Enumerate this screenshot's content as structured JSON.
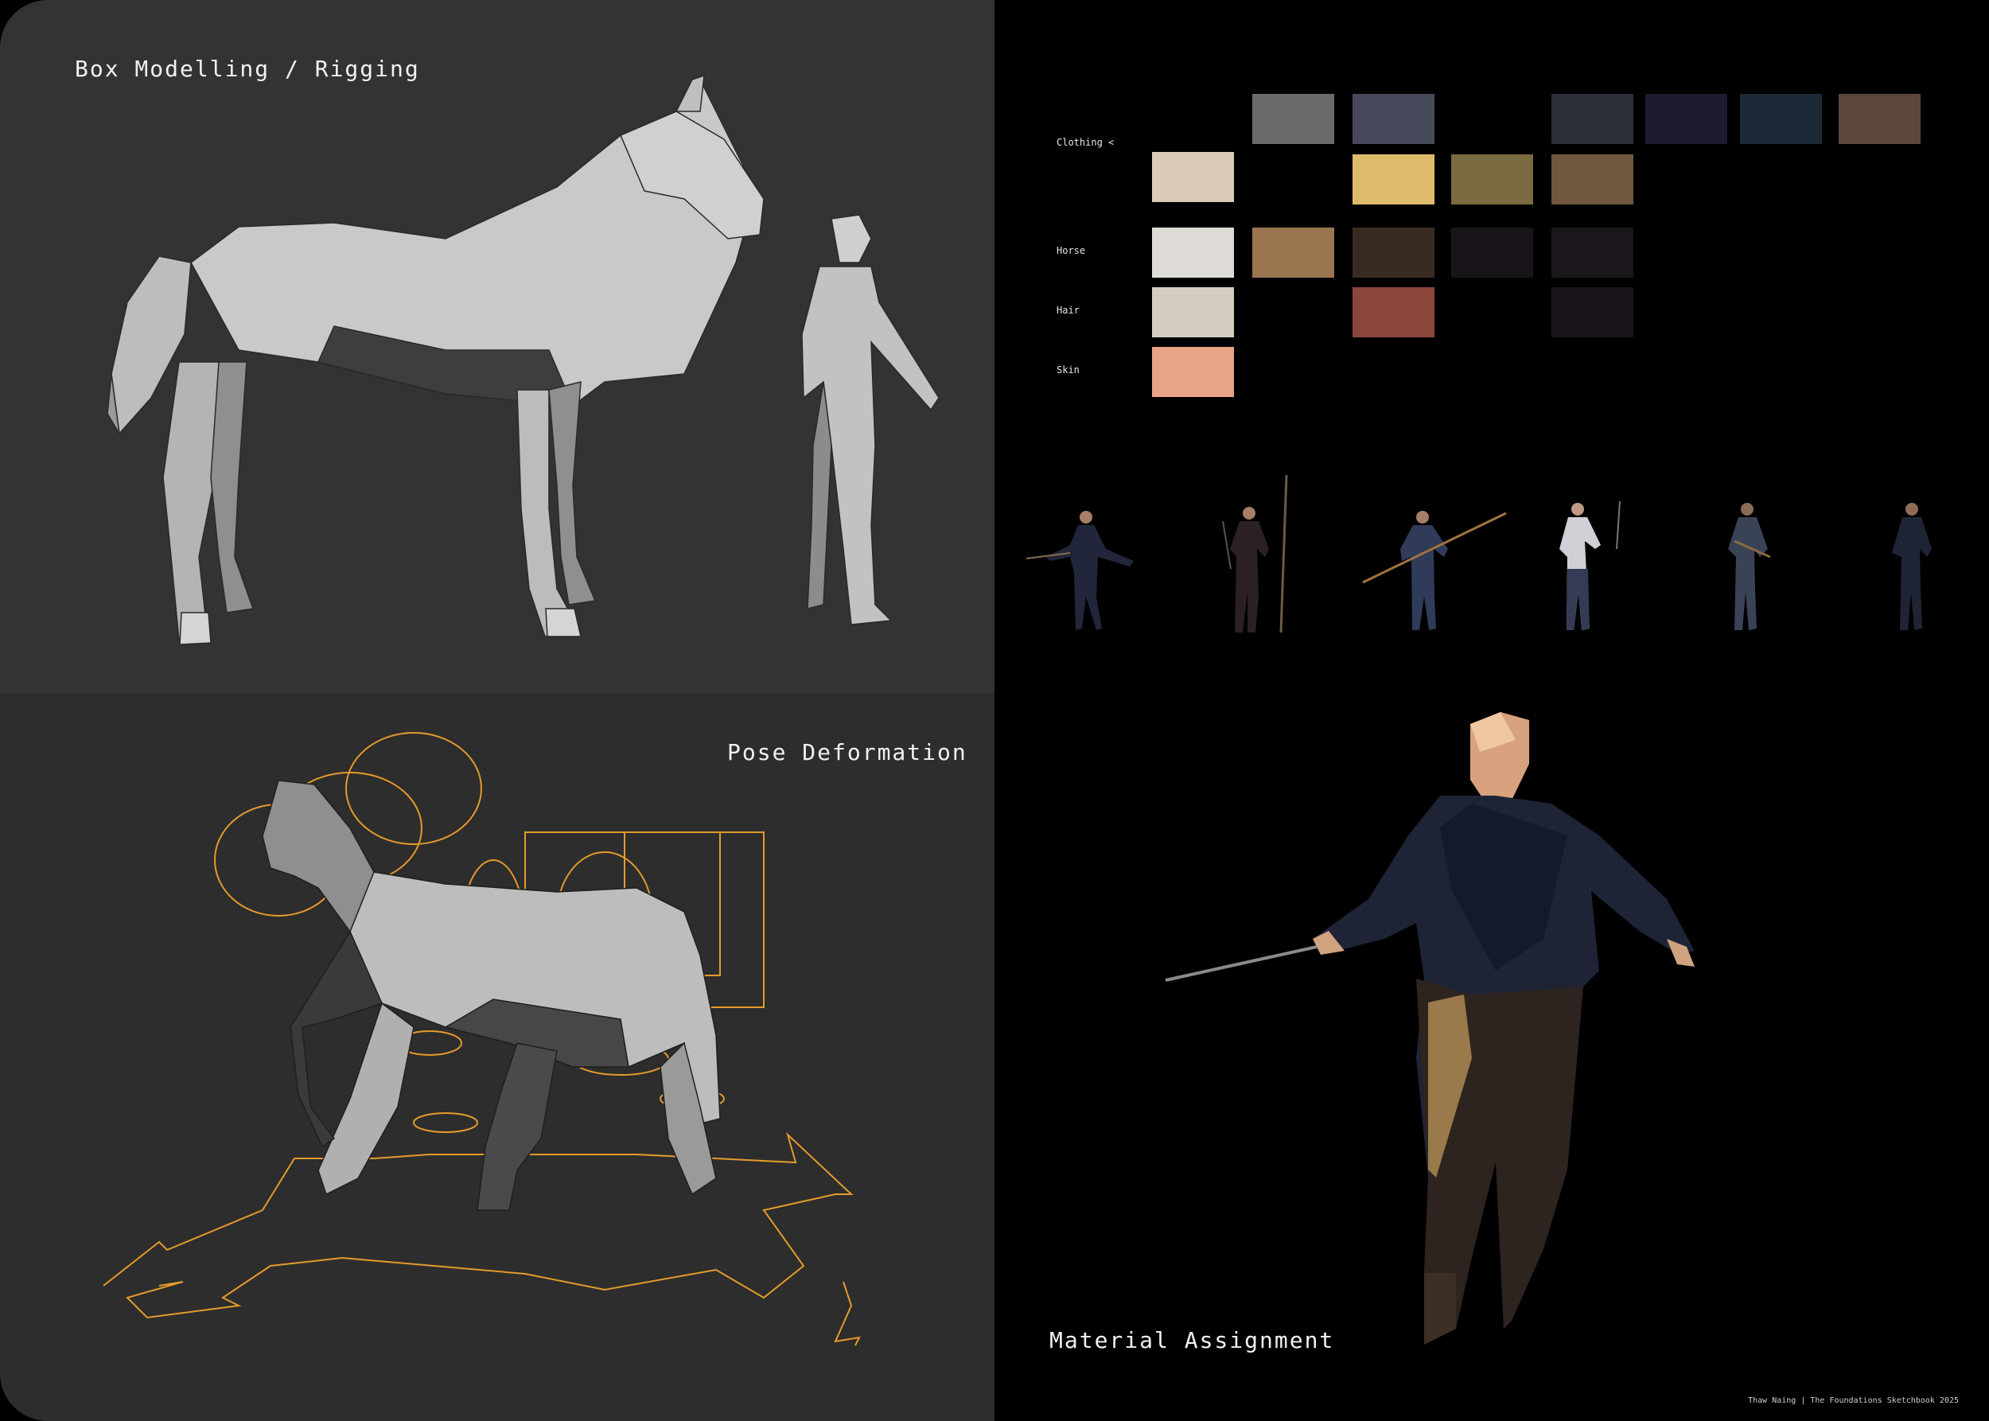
{
  "panels": {
    "modelling": {
      "title": "Box Modelling / Rigging"
    },
    "pose": {
      "title": "Pose Deformation"
    },
    "material": {
      "title": "Material Assignment"
    }
  },
  "palette": {
    "rows": [
      {
        "label": "Clothing <",
        "swatches": [
          "#6a6a6a",
          "#474a5a",
          "#2d2f38",
          "#1d1c2e",
          "#1c2a38",
          "#5b473b",
          "#dbcab9",
          "#deba6b",
          "#7a6a3f",
          "#6f563c"
        ]
      },
      {
        "label": "Horse",
        "swatches": [
          "#dedbd6",
          "#9a7650",
          "#3a2b22",
          "#19141a",
          "#1b161b"
        ]
      },
      {
        "label": "Hair",
        "swatches": [
          "#d3cdbf",
          "#8b463b",
          "#19151a"
        ]
      },
      {
        "label": "Skin",
        "swatches": [
          "#e8a585"
        ]
      }
    ]
  },
  "colors": {
    "rig_orange": "#e59a2a",
    "mesh_light": "#c9c9c9",
    "mesh_dark": "#3a3a3a",
    "panel_dark_grey": "#333333"
  },
  "credit": "Thaw Naing | The Foundations Sketchbook 2025"
}
